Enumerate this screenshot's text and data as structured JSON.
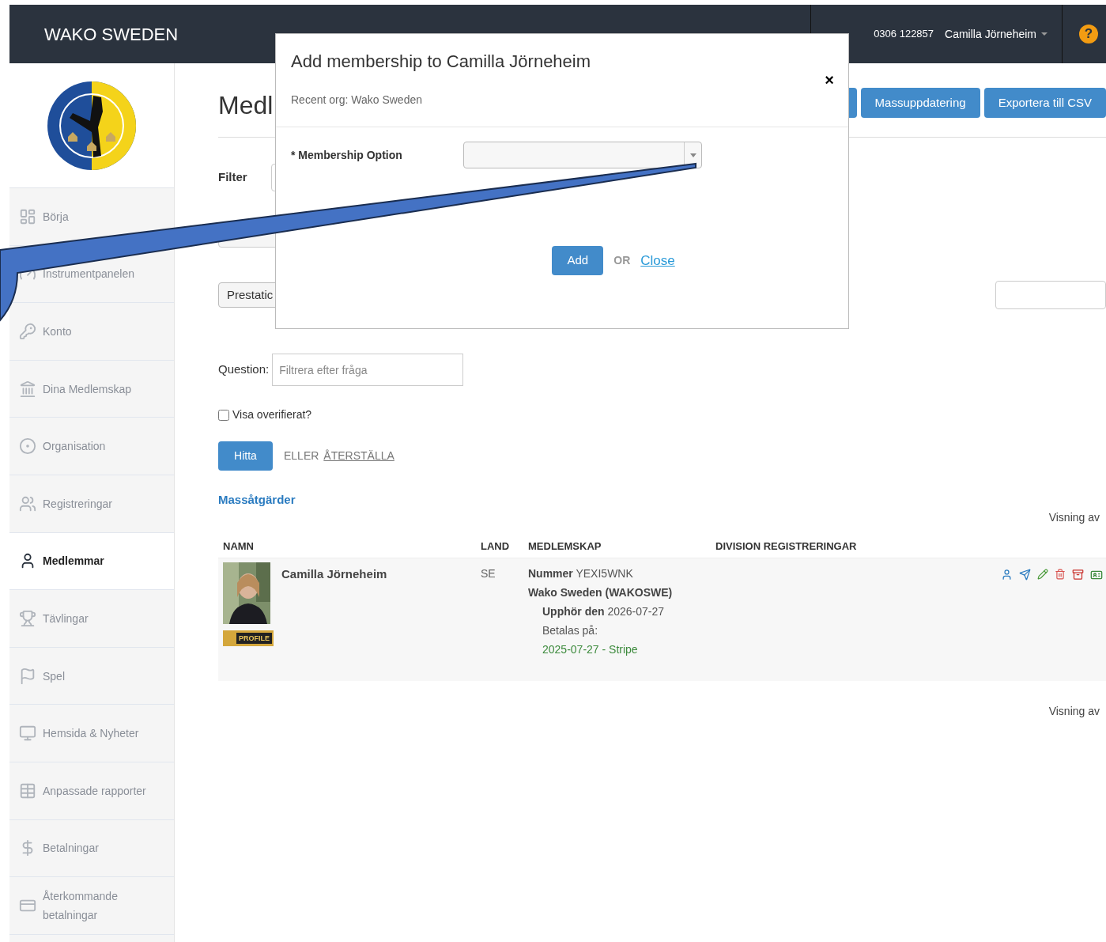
{
  "top_bar": {
    "brand": "WAKO SWEDEN",
    "image_caption": "0306 122857",
    "user": "Camilla Jörneheim",
    "help": "?"
  },
  "sidebar": {
    "items": [
      {
        "label": "Börja",
        "selected": false
      },
      {
        "label": "Instrumentpanelen",
        "selected": false
      },
      {
        "label": "Konto",
        "selected": false
      },
      {
        "label": "Dina Medlemskap",
        "selected": false
      },
      {
        "label": "Organisation",
        "selected": false
      },
      {
        "label": "Registreringar",
        "selected": false
      },
      {
        "label": "Medlemmar",
        "selected": true
      },
      {
        "label": "Tävlingar",
        "selected": false
      },
      {
        "label": "Spel",
        "selected": false
      },
      {
        "label": "Hemsida & Nyheter",
        "selected": false
      },
      {
        "label": "Anpassade rapporter",
        "selected": false
      },
      {
        "label": "Betalningar",
        "selected": false
      },
      {
        "label": "Återkommande betalningar",
        "selected": false
      }
    ]
  },
  "page": {
    "title": "Medl",
    "actions": [
      "Massuppdatering",
      "Exportera till CSV"
    ],
    "filter_label": "Filter",
    "prestation_button": "Prestatic",
    "question_label": "Question:",
    "question_placeholder": "Filtrera efter fråga",
    "unverified": {
      "label": "Visa overifierat?",
      "checked": false
    },
    "find_button": "Hitta",
    "or_text": "ELLER",
    "reset_link": "ÅTERSTÄLLA",
    "bulk_actions": "Massåtgärder",
    "showing_top": "Visning av",
    "showing_bottom": "Visning av"
  },
  "table": {
    "columns": [
      "NAMN",
      "LAND",
      "MEDLEMSKAP",
      "DIVISION REGISTRERINGAR"
    ],
    "rows": [
      {
        "name": "Camilla Jörneheim",
        "badge": "PROFILE",
        "country": "SE",
        "number_label": "Nummer",
        "number": "YEXI5WNK",
        "org": "Wako Sweden (WAKOSWE)",
        "expires_label": "Upphör den",
        "expires": "2026-07-27",
        "paid_label": "Betalas på:",
        "payment": "2025-07-27 - Stripe"
      }
    ]
  },
  "dialog": {
    "title": "Add membership to Camilla Jörneheim",
    "close": "×",
    "recent_org": "Recent org: Wako Sweden",
    "field_label": "* Membership Option",
    "add_button": "Add",
    "or_text": "OR",
    "close_link": "Close"
  }
}
